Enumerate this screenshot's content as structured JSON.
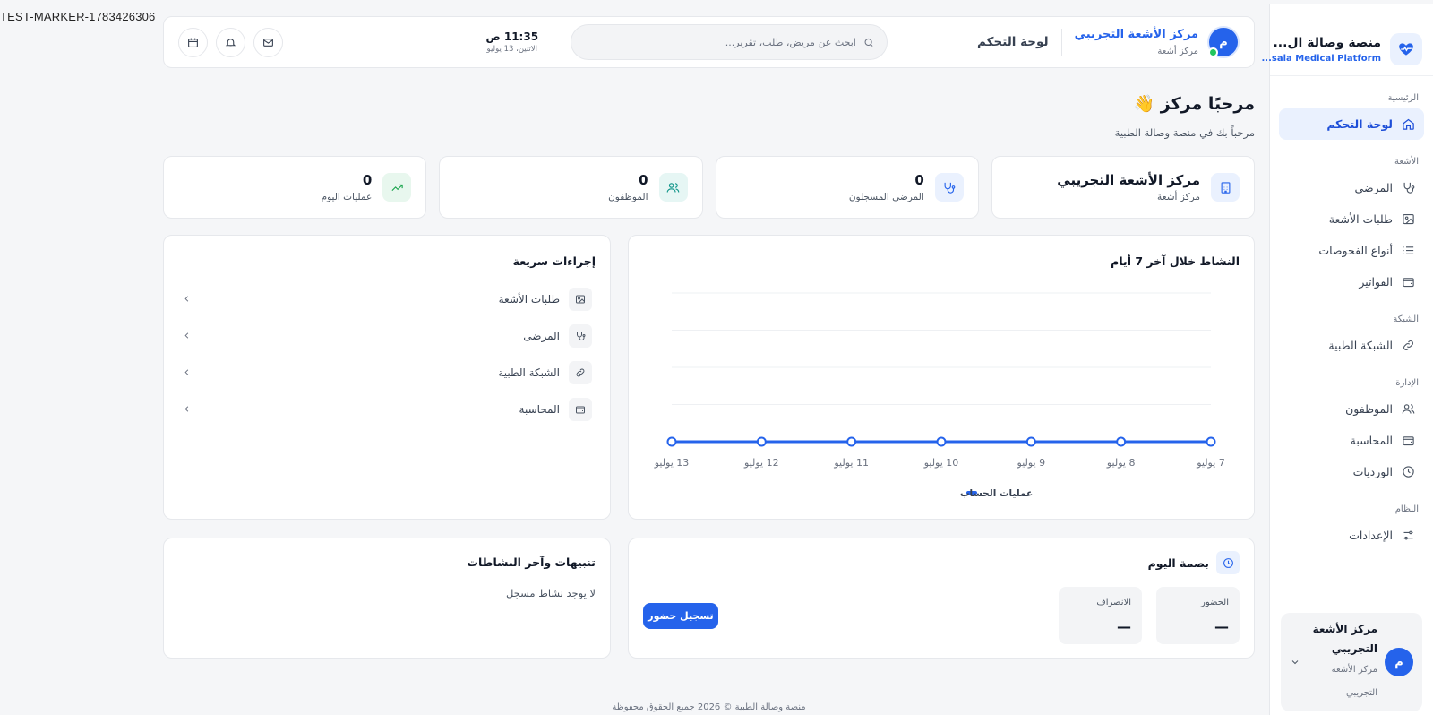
{
  "marker": "TEST-MARKER-1783426306",
  "sidebar": {
    "brand_title": "منصة وصالة ال...",
    "brand_sub": "...sala Medical Platform",
    "sections": {
      "home": "الرئيسية",
      "radiology": "الأشعة",
      "network": "الشبكة",
      "admin": "الإدارة",
      "system": "النظام"
    },
    "items": {
      "dashboard": "لوحة التحكم",
      "patients": "المرضى",
      "xray_requests": "طلبات الأشعة",
      "exam_types": "أنواع الفحوصات",
      "invoices": "الفواتير",
      "medical_network": "الشبكة الطبية",
      "staff": "الموظفون",
      "accounting": "المحاسبة",
      "shifts": "الورديات",
      "settings": "الإعدادات"
    },
    "user": {
      "avatar_letter": "م",
      "name_line1": "مركز الأشعة",
      "name_line2": "التجريبي",
      "role_line1": "مركز الأشعة",
      "role_line2": "التجريبي"
    }
  },
  "header": {
    "avatar_letter": "م",
    "center_name": "مركز الأشعة التجريبي",
    "center_type": "مركز أشعة",
    "page_title": "لوحة التحكم",
    "search_placeholder": "ابحث عن مريض، طلب، تقرير...",
    "time": "11:35 ص",
    "date": "الاثنين، 13 يوليو"
  },
  "welcome": {
    "title": "مرحبًا مركز 👋",
    "subtitle": "مرحباً بك في منصة وصالة الطبية"
  },
  "stats": {
    "center": {
      "title": "مركز الأشعة التجريبي",
      "label": "مركز أشعة"
    },
    "patients": {
      "value": "0",
      "label": "المرضى المسجلون"
    },
    "staff": {
      "value": "0",
      "label": "الموظفون"
    },
    "today_ops": {
      "value": "0",
      "label": "عمليات اليوم"
    }
  },
  "activity": {
    "title": "النشاط خلال آخر 7 أيام"
  },
  "chart_data": {
    "type": "line",
    "title": "النشاط خلال آخر 7 أيام",
    "categories": [
      "7 يوليو",
      "8 يوليو",
      "9 يوليو",
      "10 يوليو",
      "11 يوليو",
      "12 يوليو",
      "13 يوليو"
    ],
    "series": [
      {
        "name": "عمليات الحساب",
        "values": [
          0,
          0,
          0,
          0,
          0,
          0,
          0
        ],
        "color": "#2563eb"
      }
    ],
    "ylim": [
      0,
      4
    ],
    "grid": true,
    "legend": "bottom-center",
    "x_direction": "rtl"
  },
  "quick_actions": {
    "title": "إجراءات سريعة",
    "items": [
      "طلبات الأشعة",
      "المرضى",
      "الشبكة الطبية",
      "المحاسبة"
    ]
  },
  "attendance": {
    "title": "بصمة اليوم",
    "checkin_label": "الحضور",
    "checkin_value": "—",
    "checkout_label": "الانصراف",
    "checkout_value": "—",
    "button": "تسجيل حضور"
  },
  "alerts": {
    "title": "تنبيهات وآخر النشاطات",
    "empty": "لا يوجد نشاط مسجل"
  },
  "footer": "منصة وصالة الطبية © 2026 جميع الحقوق محفوظة",
  "colors": {
    "accent": "#2563eb",
    "accent_soft": "#eaf1fe",
    "green": "#16a34a",
    "teal": "#0d9488"
  }
}
